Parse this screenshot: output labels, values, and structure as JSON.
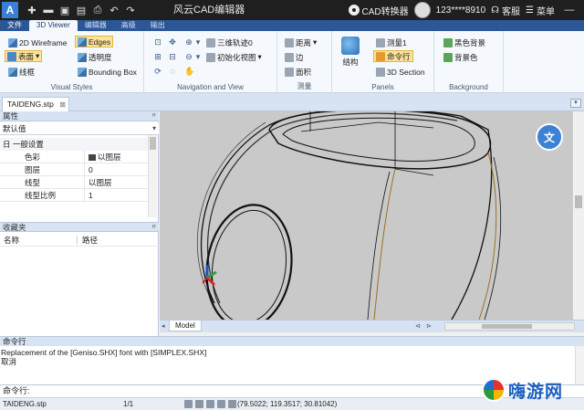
{
  "titlebar": {
    "logo": "A",
    "app_title": "风云CAD编辑器",
    "converter_label": "CAD转换器",
    "user": "123****8910",
    "service_label": "客服",
    "menu_label": "菜单",
    "qat_icons": [
      "new-icon",
      "open-icon",
      "save-icon",
      "save-as-icon",
      "print-icon",
      "undo-icon",
      "redo-icon"
    ]
  },
  "menutabs": [
    "文件",
    "3D Viewer",
    "编辑器",
    "高级",
    "输出"
  ],
  "ribbon": {
    "visual_styles": {
      "label": "Visual Styles",
      "wireframe_2d": "2D Wireframe",
      "edges": "Edges",
      "surface": "表面",
      "transparency": "透明度",
      "wireframe": "线框",
      "bounding_box": "Bounding Box"
    },
    "navigation": {
      "label": "Navigation and View",
      "orbit": "三维轨迹0",
      "init_view": "初始化视图"
    },
    "measure": {
      "label": "测量",
      "distance": "距离",
      "edge": "边",
      "area": "面积"
    },
    "panels": {
      "label": "Panels",
      "structure": "结构",
      "measure1": "测量1",
      "command_line": "命令行",
      "section_3d": "3D Section"
    },
    "background": {
      "label": "Background",
      "black_bg": "黑色背景",
      "bg_color": "背景色"
    }
  },
  "doc_tab": {
    "name": "TAIDENG.stp",
    "close": "⊠"
  },
  "properties": {
    "title": "属性",
    "pin": "ꟸ",
    "selector": "默认值",
    "group": "日 一般设置",
    "rows": [
      {
        "key": "色彩",
        "value": "以图层",
        "swatch": "#444444"
      },
      {
        "key": "图层",
        "value": "0"
      },
      {
        "key": "线型",
        "value": "以图层"
      },
      {
        "key": "线型比例",
        "value": "1"
      }
    ]
  },
  "favorites": {
    "title": "收藏夹",
    "col_name": "名称",
    "col_path": "路径"
  },
  "viewport": {
    "model_tab": "Model",
    "float_icon": "translate-icon",
    "bg_color": "#c9c9c9"
  },
  "command": {
    "title": "命令行",
    "output": [
      "Replacement of the [Geniso.SHX] font with [SIMPLEX.SHX]",
      "取消"
    ],
    "prompt": "命令行:",
    "input_value": ""
  },
  "status": {
    "file": "TAIDENG.stp",
    "page": "1/1",
    "coords": "(79.5022; 119.3517; 30.81042)"
  },
  "watermark": {
    "text": "嗨游网"
  }
}
